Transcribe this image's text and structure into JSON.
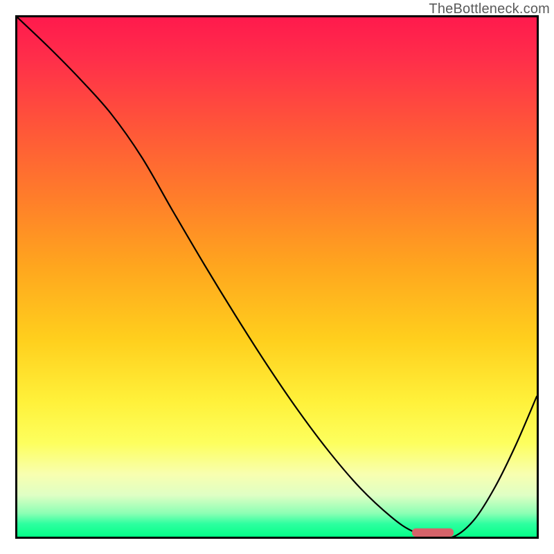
{
  "watermark": "TheBottleneck.com",
  "chart_data": {
    "type": "line",
    "title": "",
    "xlabel": "",
    "ylabel": "",
    "xlim": [
      0,
      100
    ],
    "ylim": [
      0,
      100
    ],
    "x": [
      0,
      6,
      12,
      18,
      24,
      30,
      36,
      42,
      48,
      54,
      60,
      66,
      72,
      76,
      80,
      84,
      88,
      92,
      96,
      100
    ],
    "y": [
      100,
      94.3,
      88.2,
      81.5,
      73.0,
      62.6,
      52.4,
      42.6,
      33.2,
      24.4,
      16.4,
      9.4,
      3.8,
      1.1,
      0.0,
      0.0,
      3.3,
      9.6,
      17.7,
      27.0
    ],
    "marker_segment": {
      "x_start": 76,
      "x_end": 84,
      "y": 0
    }
  }
}
